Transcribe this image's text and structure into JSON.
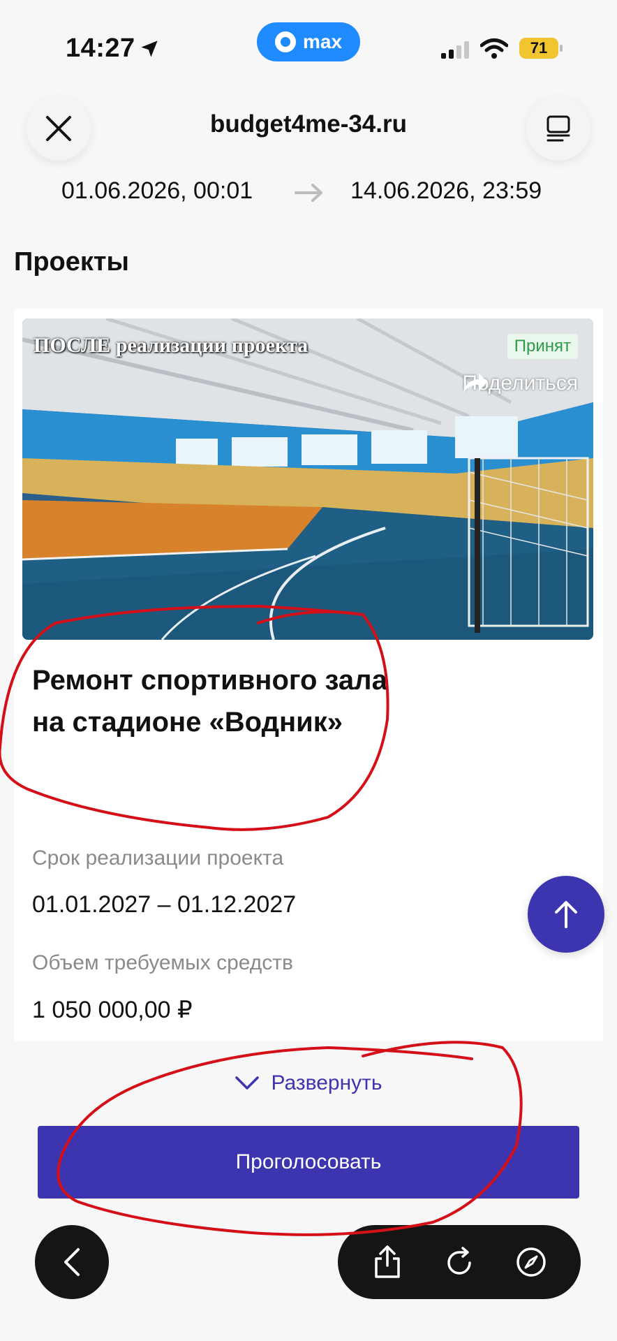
{
  "status_bar": {
    "time": "14:27",
    "max_label": "max",
    "battery": "71"
  },
  "header": {
    "site": "budget4me-34.ru",
    "close_icon": "close-icon",
    "menu_icon": "reader-menu-icon"
  },
  "date_range": {
    "start": "01.06.2026, 00:01",
    "end": "14.06.2026, 23:59"
  },
  "section": {
    "title": "Проекты"
  },
  "project": {
    "photo_caption": "ПОСЛЕ реализации проекта",
    "status": "Принят",
    "share": "Поделиться",
    "title": "Ремонт спортивного зала на стадионе «Водник»",
    "term_label": "Срок реализации проекта",
    "term_value": "01.01.2027 – 01.12.2027",
    "amount_label": "Объем требуемых средств",
    "amount_value": "1 050 000,00 ₽"
  },
  "actions": {
    "expand": "Развернуть",
    "vote": "Проголосовать"
  },
  "colors": {
    "accent": "#3d35b0",
    "status_green": "#2e9a4a",
    "annotation_red": "#d40f17"
  }
}
